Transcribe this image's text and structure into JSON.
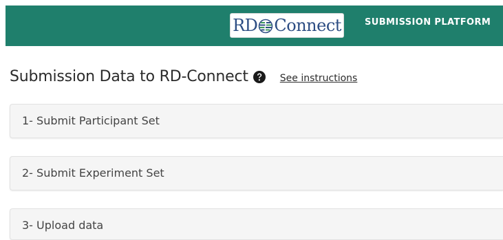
{
  "header": {
    "logo": {
      "text_before": "RD",
      "text_after": "Connect",
      "icon": "globe-icon"
    },
    "platform_label": "SUBMISSION PLATFORM"
  },
  "page": {
    "title": "Submission Data to RD-Connect",
    "help_icon": "question-circle-icon",
    "instructions_link": "See instructions"
  },
  "steps": [
    {
      "label": "1- Submit Participant Set"
    },
    {
      "label": "2- Submit Experiment Set"
    },
    {
      "label": "3- Upload data"
    }
  ],
  "colors": {
    "header_bg": "#1f7f6c",
    "logo_text": "#2d4d83",
    "panel_bg": "#f5f5f5"
  }
}
